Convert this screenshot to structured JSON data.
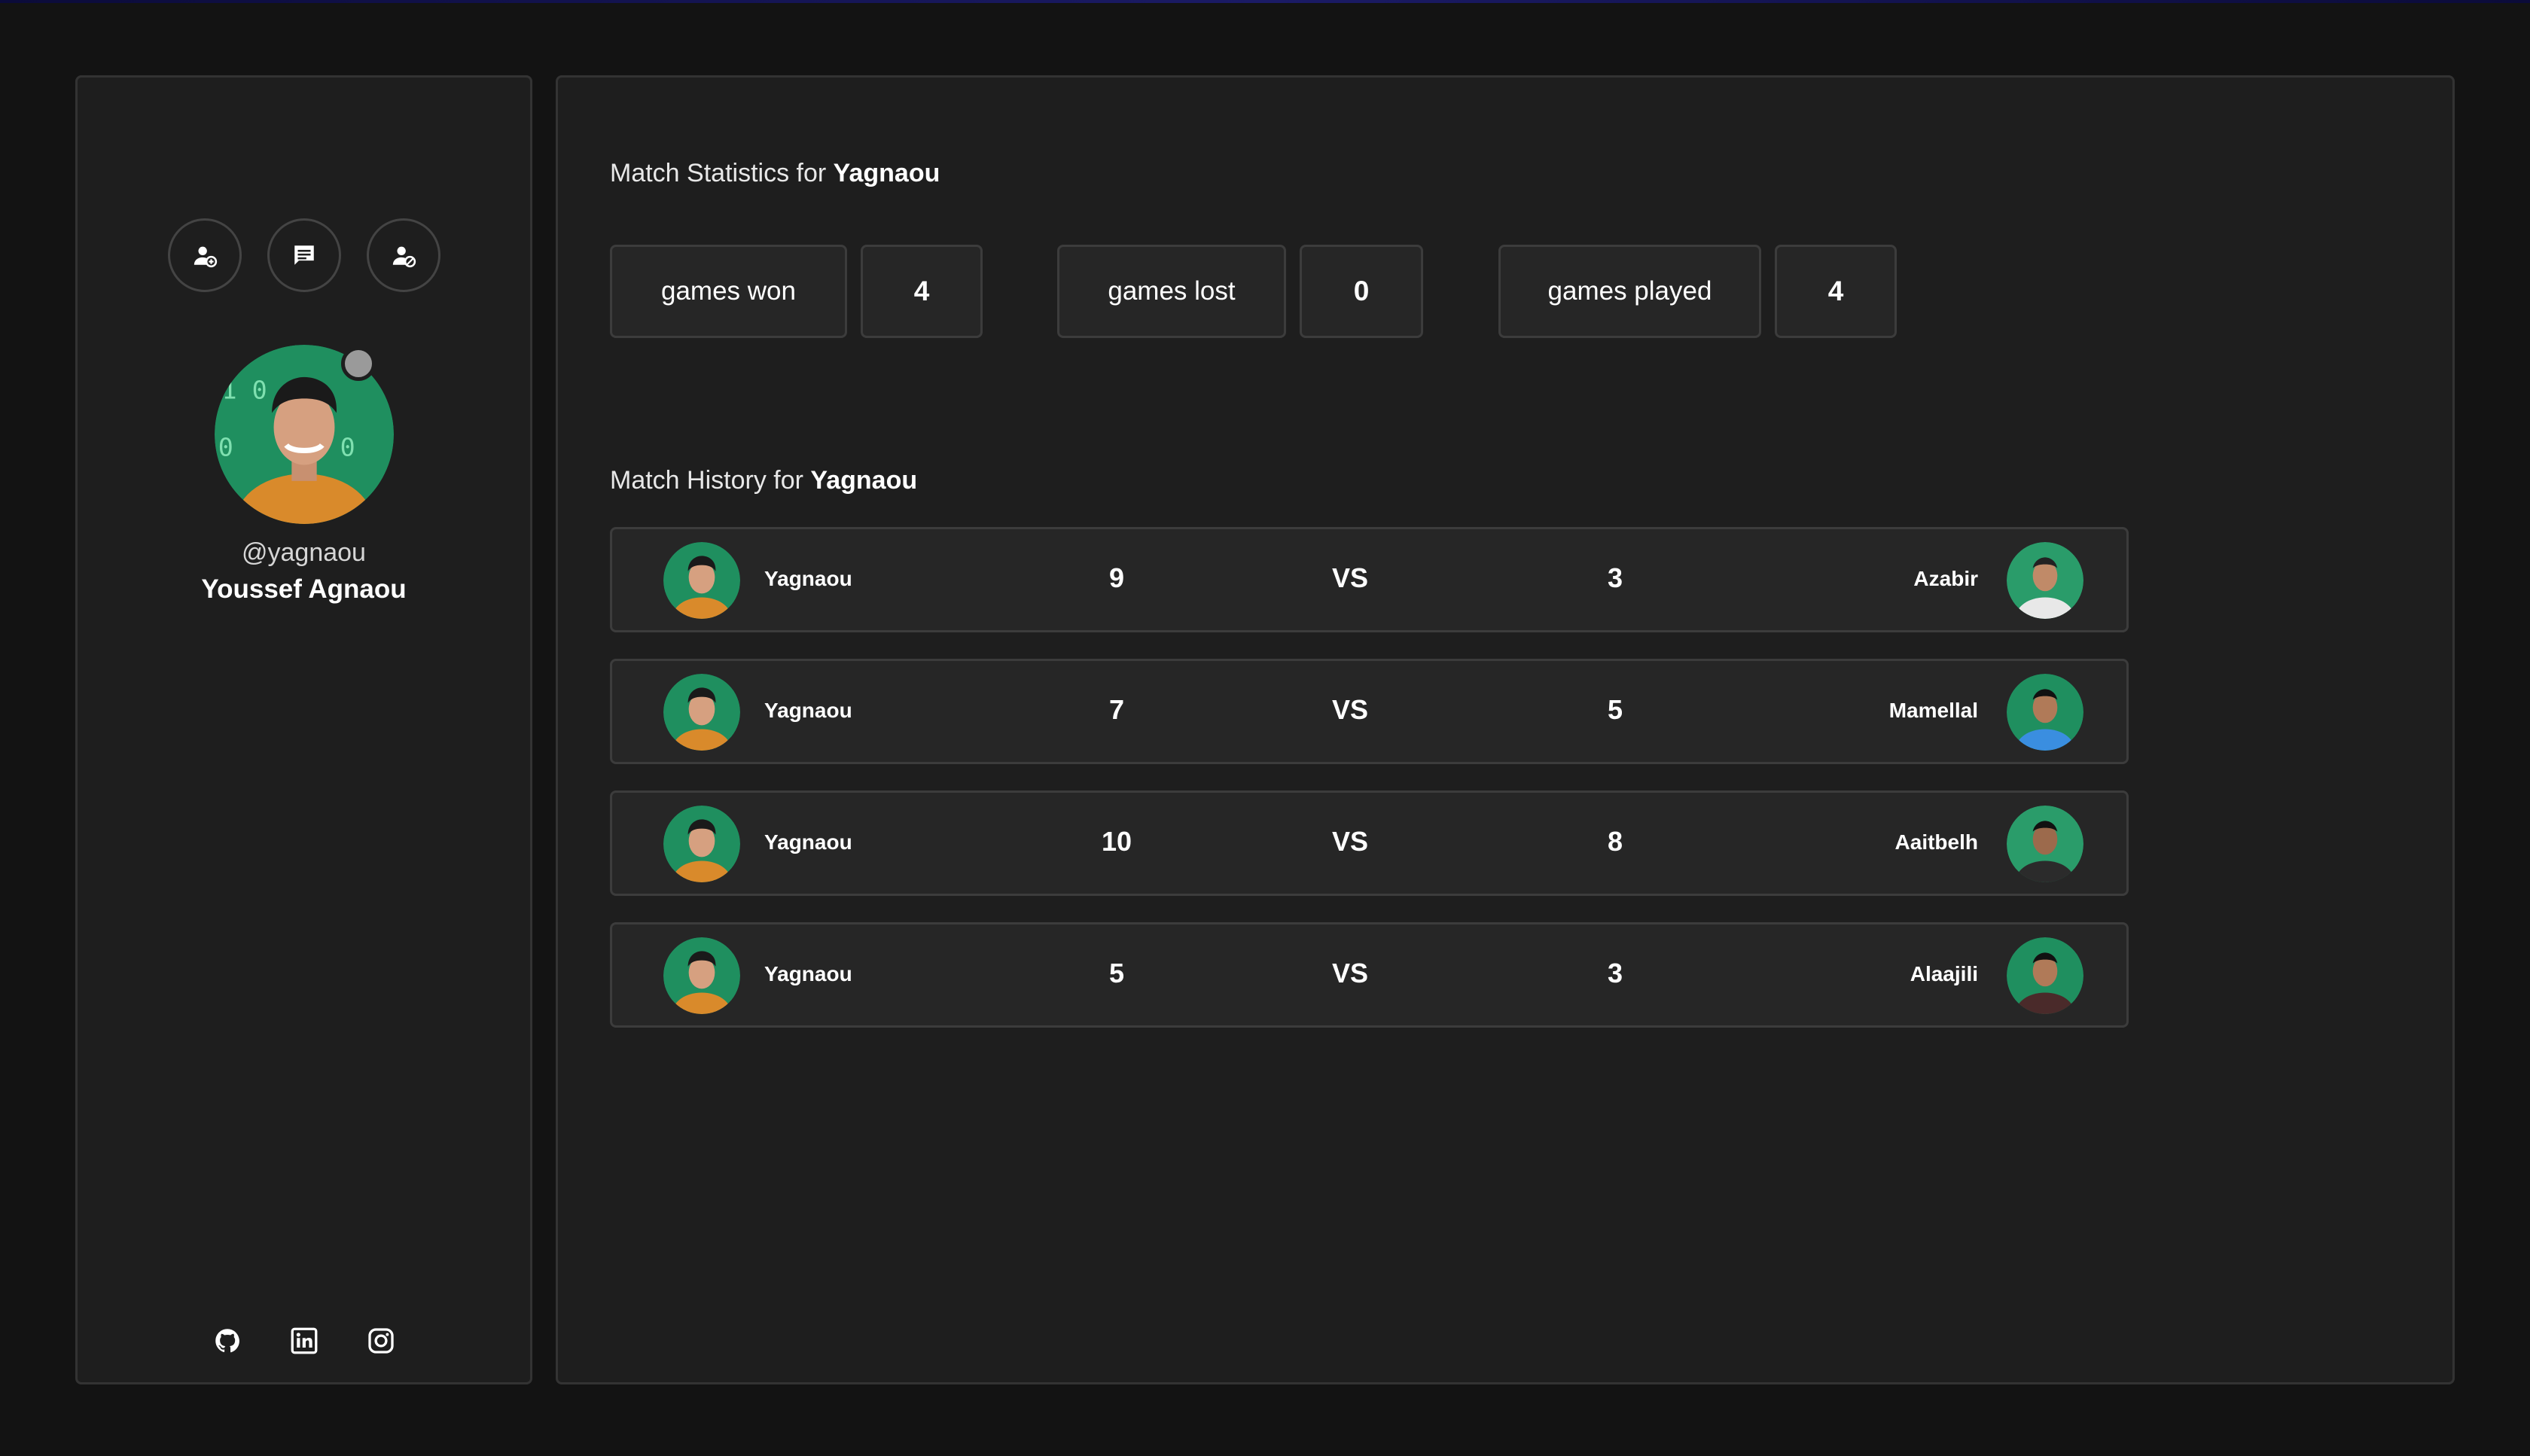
{
  "profile": {
    "handle": "@yagnaou",
    "full_name": "Youssef Agnaou",
    "status_color": "#9a9a9a",
    "actions": [
      {
        "icon": "add-friend-icon"
      },
      {
        "icon": "message-icon"
      },
      {
        "icon": "block-user-icon"
      }
    ],
    "socials": [
      {
        "icon": "github-icon"
      },
      {
        "icon": "linkedin-icon"
      },
      {
        "icon": "instagram-icon"
      }
    ]
  },
  "stats": {
    "title_prefix": "Match Statistics for",
    "title_user": "Yagnaou",
    "items": [
      {
        "label": "games won",
        "value": "4"
      },
      {
        "label": "games lost",
        "value": "0"
      },
      {
        "label": "games played",
        "value": "4"
      }
    ]
  },
  "history": {
    "title_prefix": "Match History for",
    "title_user": "Yagnaou",
    "vs_label": "VS",
    "matches": [
      {
        "player": "Yagnaou",
        "player_score": "9",
        "opponent_score": "3",
        "opponent": "Azabir"
      },
      {
        "player": "Yagnaou",
        "player_score": "7",
        "opponent_score": "5",
        "opponent": "Mamellal"
      },
      {
        "player": "Yagnaou",
        "player_score": "10",
        "opponent_score": "8",
        "opponent": "Aaitbelh"
      },
      {
        "player": "Yagnaou",
        "player_score": "5",
        "opponent_score": "3",
        "opponent": "Alaajili"
      }
    ]
  },
  "colors": {
    "background": "#131313",
    "panel": "#1e1e1e",
    "box": "#262626",
    "border": "#3c3c3c",
    "avatar_green": "#1f8f5f",
    "avatar_hoodie": "#d98a2b"
  }
}
